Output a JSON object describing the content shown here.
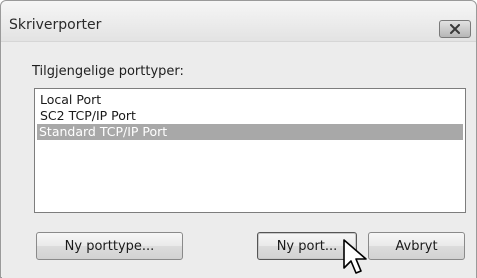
{
  "window": {
    "title": "Skriverporter"
  },
  "dialog": {
    "group_label": "Tilgjengelige porttyper:",
    "port_types": [
      {
        "label": "Local Port",
        "selected": false
      },
      {
        "label": "SC2 TCP/IP Port",
        "selected": false
      },
      {
        "label": "Standard TCP/IP Port",
        "selected": true
      }
    ]
  },
  "buttons": {
    "new_port_type": "Ny porttype...",
    "new_port": "Ny port...",
    "cancel": "Avbryt"
  },
  "icons": {
    "close": "close-icon",
    "cursor": "pointer-cursor-icon"
  },
  "colors": {
    "selection": "#a8a8a8",
    "window_bg": "#ececec"
  }
}
